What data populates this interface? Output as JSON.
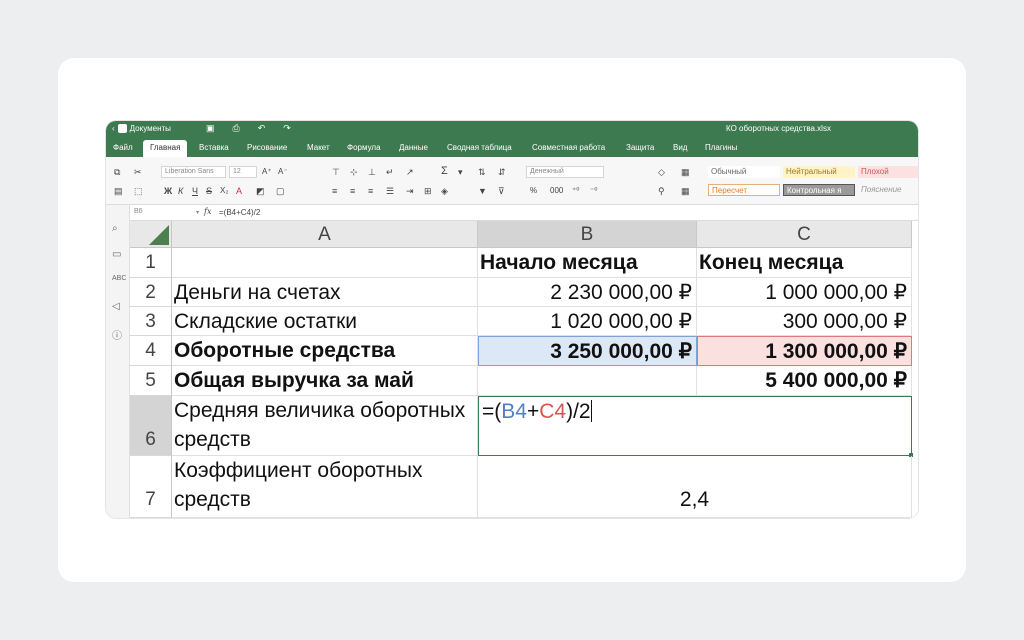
{
  "titlebar": {
    "docs_label": "Документы",
    "filename": "КО оборотных средства.xlsx"
  },
  "tabs": [
    "Файл",
    "Главная",
    "Вставка",
    "Рисование",
    "Макет",
    "Формула",
    "Данные",
    "Сводная таблица",
    "Совместная работа",
    "Защита",
    "Вид",
    "Плагины"
  ],
  "toolbar": {
    "font_name": "Liberation Sans",
    "font_size": "12",
    "number_format": "Денежный",
    "styles": {
      "normal": "Обычный",
      "neutral": "Нейтральный",
      "bad": "Плохой",
      "recalc": "Пересчет",
      "control": "Контрольная я",
      "note": "Пояснение"
    }
  },
  "formula_bar": {
    "cell_ref": "B6",
    "fx": "fx",
    "formula": "=(B4+C4)/2"
  },
  "columns": [
    "A",
    "B",
    "C"
  ],
  "rows": [
    "1",
    "2",
    "3",
    "4",
    "5",
    "6",
    "7"
  ],
  "cells": {
    "B1": "Начало месяца",
    "C1": "Конец месяца",
    "A2": "Деньги на счетах",
    "B2": "2 230 000,00 ₽",
    "C2": "1 000 000,00 ₽",
    "A3": "Складские остатки",
    "B3": "1 020 000,00 ₽",
    "C3": "300 000,00 ₽",
    "A4": "Оборотные средства",
    "B4": "3 250 000,00 ₽",
    "C4": "1 300 000,00 ₽",
    "A5": "Общая выручка за май",
    "C5": "5 400 000,00 ₽",
    "A6": "Средняя величика оборотных средств",
    "A7": "Коэффициент оборотных средств",
    "B7": "2,4"
  },
  "edit": {
    "prefix": "=(",
    "ref1": "B4",
    "op": "+",
    "ref2": "C4",
    "suffix": ")/2"
  },
  "colors": {
    "accent": "#3d7a4f",
    "ref1": "#4f7fc7",
    "ref2": "#d9534f"
  }
}
